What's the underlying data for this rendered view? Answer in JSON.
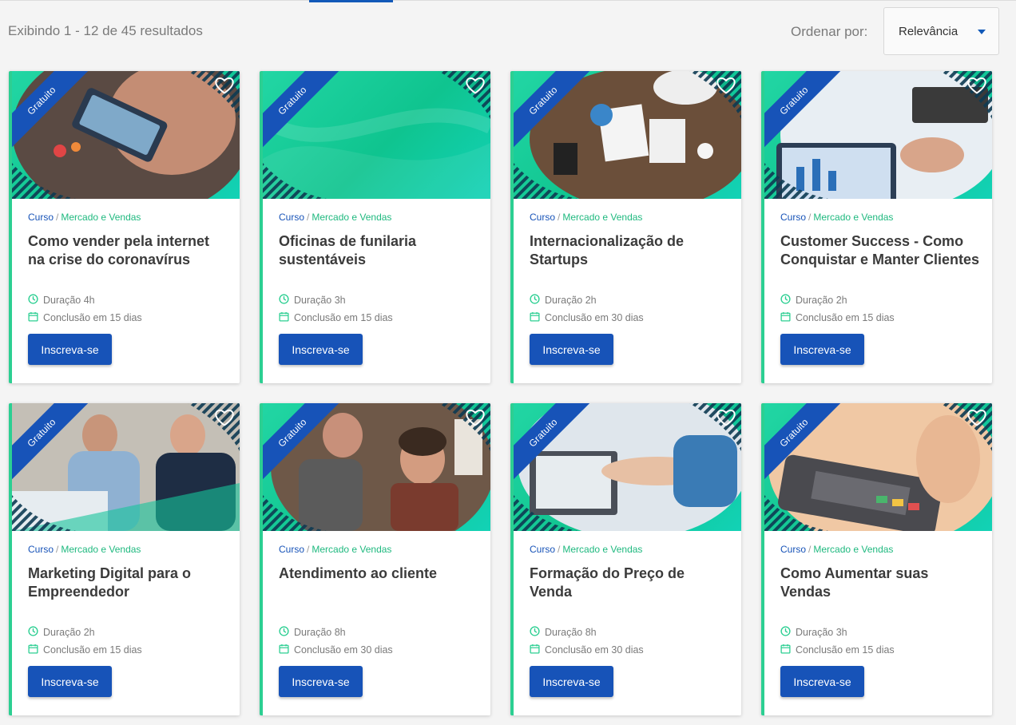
{
  "header": {
    "results_text": "Exibindo 1 - 12 de 45 resultados",
    "sort_label": "Ordenar por:",
    "sort_value": "Relevância"
  },
  "colors": {
    "brand_blue": "#1753b8",
    "brand_green": "#2ccf92",
    "category_green": "#1fb97f"
  },
  "cards": [
    {
      "badge": "Gratuito",
      "type": "Curso",
      "category": "Mercado e Vendas",
      "title": "Como vender pela internet na crise do coronavírus",
      "duration": "Duração 4h",
      "conclusion": "Conclusão em 15 dias",
      "button": "Inscreva-se",
      "image": "phone-hands-photo"
    },
    {
      "badge": "Gratuito",
      "type": "Curso",
      "category": "Mercado e Vendas",
      "title": "Oficinas de funilaria sustentáveis",
      "duration": "Duração 3h",
      "conclusion": "Conclusão em 15 dias",
      "button": "Inscreva-se",
      "image": "green-waves"
    },
    {
      "badge": "Gratuito",
      "type": "Curso",
      "category": "Mercado e Vendas",
      "title": "Internacionalização de Startups",
      "duration": "Duração 2h",
      "conclusion": "Conclusão em 30 dias",
      "button": "Inscreva-se",
      "image": "meeting-table-photo"
    },
    {
      "badge": "Gratuito",
      "type": "Curso",
      "category": "Mercado e Vendas",
      "title": "Customer Success - Como Conquistar e Manter Clientes",
      "duration": "Duração 2h",
      "conclusion": "Conclusão em 15 dias",
      "button": "Inscreva-se",
      "image": "tablet-charts-photo"
    },
    {
      "badge": "Gratuito",
      "type": "Curso",
      "category": "Mercado e Vendas",
      "title": "Marketing Digital para o Empreendedor",
      "duration": "Duração 2h",
      "conclusion": "Conclusão em 15 dias",
      "button": "Inscreva-se",
      "image": "couple-laptop-photo"
    },
    {
      "badge": "Gratuito",
      "type": "Curso",
      "category": "Mercado e Vendas",
      "title": "Atendimento ao cliente",
      "duration": "Duração 8h",
      "conclusion": "Conclusão em 30 dias",
      "button": "Inscreva-se",
      "image": "barbershop-photo"
    },
    {
      "badge": "Gratuito",
      "type": "Curso",
      "category": "Mercado e Vendas",
      "title": "Formação do Preço de Venda",
      "duration": "Duração 8h",
      "conclusion": "Conclusão em 30 dias",
      "button": "Inscreva-se",
      "image": "handshake-laptop-photo"
    },
    {
      "badge": "Gratuito",
      "type": "Curso",
      "category": "Mercado e Vendas",
      "title": "Como Aumentar suas Vendas",
      "duration": "Duração 3h",
      "conclusion": "Conclusão em 15 dias",
      "button": "Inscreva-se",
      "image": "card-terminal-photo"
    }
  ]
}
